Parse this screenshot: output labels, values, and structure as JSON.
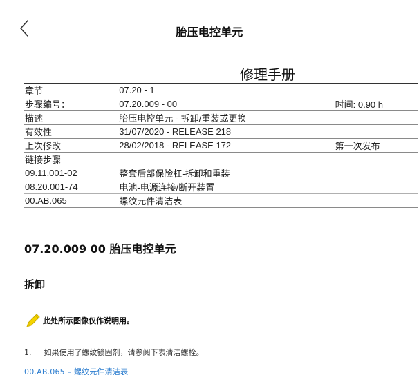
{
  "header": {
    "title": "胎压电控单元",
    "back_icon": "chevron-left-icon"
  },
  "manual": {
    "title": "修理手册"
  },
  "info_rows": [
    {
      "label": "章节",
      "value": "07.20 - 1",
      "extra": ""
    },
    {
      "label": "步骤编号：",
      "value": "07.20.009 - 00",
      "extra": "时间: 0.90 h"
    },
    {
      "label": "描述",
      "value": "胎压电控单元 - 拆卸/重装或更换",
      "extra": ""
    },
    {
      "label": "有效性",
      "value": "31/07/2020 - RELEASE 218",
      "extra": ""
    },
    {
      "label": "上次修改",
      "value": "28/02/2018 - RELEASE 172",
      "extra": "第一次发布"
    },
    {
      "label": "链接步骤",
      "value": "",
      "extra": ""
    },
    {
      "label": "09.11.001-02",
      "value": "整套后部保险杠-拆卸和重装",
      "extra": ""
    },
    {
      "label": "08.20.001-74",
      "value": "电池-电源连接/断开装置",
      "extra": ""
    },
    {
      "label": "00.AB.065",
      "value": "螺纹元件清洁表",
      "extra": ""
    }
  ],
  "content": {
    "section_title": "07.20.009 00 胎压电控单元",
    "subsection_title": "拆卸",
    "note": "此处所示图像仅作说明用。",
    "note_icon": "pencil-icon",
    "step_number": "1.",
    "step_text": "如果使用了螺纹锁固剂，请参阅下表清洁螺栓。",
    "link_text": "00.AB.065 – 螺纹元件清洁表"
  },
  "colors": {
    "link": "#2f7fd0",
    "pencil": "#f5d400"
  }
}
